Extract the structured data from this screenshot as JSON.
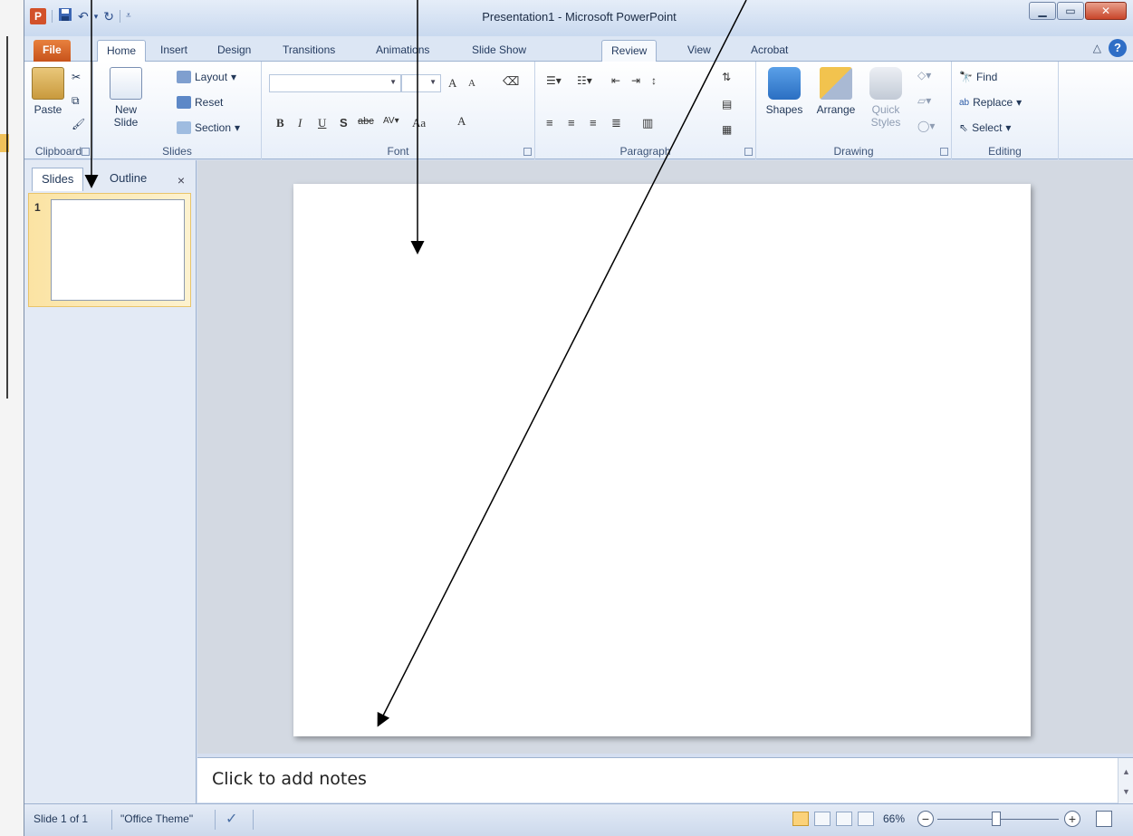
{
  "window": {
    "title": "Presentation1  -  Microsoft PowerPoint",
    "app_icon_letter": "P"
  },
  "tabs": [
    {
      "label": "File"
    },
    {
      "label": "Home"
    },
    {
      "label": "Insert"
    },
    {
      "label": "Design"
    },
    {
      "label": "Transitions"
    },
    {
      "label": "Animations"
    },
    {
      "label": "Slide Show"
    },
    {
      "label": "Review"
    },
    {
      "label": "View"
    },
    {
      "label": "Acrobat"
    }
  ],
  "ribbon": {
    "clipboard": {
      "paste": "Paste",
      "label": "Clipboard"
    },
    "slides": {
      "new_slide_line1": "New",
      "new_slide_line2": "Slide",
      "layout": "Layout",
      "reset": "Reset",
      "section": "Section",
      "label": "Slides"
    },
    "font": {
      "label": "Font",
      "bold": "B",
      "italic": "I",
      "underline": "U",
      "shadow": "S",
      "strike": "abc",
      "change_case": "Aa",
      "grow": "A",
      "shrink": "A",
      "font_color": "A"
    },
    "paragraph": {
      "label": "Paragraph"
    },
    "drawing": {
      "shapes": "Shapes",
      "arrange": "Arrange",
      "quick_styles_line1": "Quick",
      "quick_styles_line2": "Styles",
      "label": "Drawing"
    },
    "editing": {
      "find": "Find",
      "replace": "Replace",
      "select": "Select",
      "label": "Editing"
    }
  },
  "left_pane": {
    "tab_slides": "Slides",
    "tab_outline": "Outline",
    "close": "×",
    "slide_number": "1"
  },
  "notes": {
    "placeholder": "Click to add notes"
  },
  "status": {
    "slide_info": "Slide 1 of 1",
    "theme": "\"Office Theme\"",
    "zoom": "66%",
    "zoom_level_percent": 66
  },
  "colors": {
    "file_tab": "#d0601f",
    "ribbon_bg": "#e8eff9",
    "thumb_highlight": "#fbe3a3",
    "editor_bg": "#d3d9e2"
  }
}
